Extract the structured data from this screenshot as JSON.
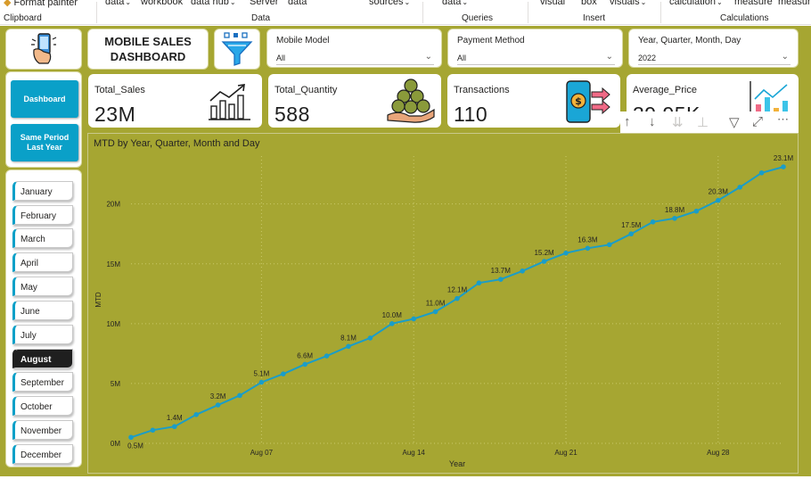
{
  "ribbon": {
    "items": [
      {
        "label": "Format painter",
        "chevron": false
      },
      {
        "label": "data",
        "chevron": true
      },
      {
        "label": "workbook",
        "chevron": false
      },
      {
        "label": "data hub",
        "chevron": true
      },
      {
        "label": "Server",
        "chevron": false
      },
      {
        "label": "data",
        "chevron": false
      },
      {
        "label": "sources",
        "chevron": true
      },
      {
        "label": "data",
        "chevron": true
      },
      {
        "label": "visual",
        "chevron": false
      },
      {
        "label": "box",
        "chevron": false
      },
      {
        "label": "visuals",
        "chevron": true
      },
      {
        "label": "calculation",
        "chevron": true
      },
      {
        "label": "measure",
        "chevron": false
      },
      {
        "label": "measure",
        "chevron": false
      }
    ],
    "groups": [
      "Clipboard",
      "Data",
      "Queries",
      "Insert",
      "Calculations"
    ]
  },
  "header": {
    "title_line1": "MOBILE SALES",
    "title_line2": "DASHBOARD",
    "phone_icon": "mobile-phone-hand-icon",
    "filter_icon": "funnel-filter-icon"
  },
  "slicers": {
    "mobile_model": {
      "label": "Mobile Model",
      "value": "All"
    },
    "payment_method": {
      "label": "Payment Method",
      "value": "All"
    },
    "date": {
      "label": "Year, Quarter, Month, Day",
      "value": "2022"
    }
  },
  "nav": {
    "dashboard": "Dashboard",
    "same_period": "Same Period Last Year"
  },
  "kpis": {
    "total_sales": {
      "label": "Total_Sales",
      "value": "23M"
    },
    "total_quantity": {
      "label": "Total_Quantity",
      "value": "588"
    },
    "transactions": {
      "label": "Transactions",
      "value": "110"
    },
    "average_price": {
      "label": "Average_Price",
      "value": "39.95K"
    }
  },
  "months": [
    "January",
    "February",
    "March",
    "April",
    "May",
    "June",
    "July",
    "August",
    "September",
    "October",
    "November",
    "December"
  ],
  "selected_month": "August",
  "colors": {
    "canvas": "#a6a632",
    "accent": "#0aa0c8",
    "line": "#1a9dc8",
    "selected": "#1f1f1f"
  },
  "chart_data": {
    "type": "line",
    "title": "MTD by Year, Quarter, Month and Day",
    "xlabel": "Year",
    "ylabel": "MTD",
    "x": [
      "Aug 01",
      "Aug 02",
      "Aug 03",
      "Aug 04",
      "Aug 05",
      "Aug 06",
      "Aug 07",
      "Aug 08",
      "Aug 09",
      "Aug 10",
      "Aug 11",
      "Aug 12",
      "Aug 13",
      "Aug 14",
      "Aug 15",
      "Aug 16",
      "Aug 17",
      "Aug 18",
      "Aug 19",
      "Aug 20",
      "Aug 21",
      "Aug 22",
      "Aug 23",
      "Aug 24",
      "Aug 25",
      "Aug 26",
      "Aug 27",
      "Aug 28",
      "Aug 29",
      "Aug 30",
      "Aug 31"
    ],
    "values": [
      0.5,
      1.1,
      1.4,
      2.4,
      3.2,
      4.0,
      5.1,
      5.8,
      6.6,
      7.3,
      8.1,
      8.8,
      10.0,
      10.4,
      11.0,
      12.1,
      13.4,
      13.7,
      14.4,
      15.2,
      15.9,
      16.3,
      16.6,
      17.5,
      18.5,
      18.8,
      19.4,
      20.3,
      21.4,
      22.6,
      23.1
    ],
    "data_labels": {
      "0": "0.5M",
      "2": "1.4M",
      "4": "3.2M",
      "6": "5.1M",
      "8": "6.6M",
      "10": "8.1M",
      "12": "10.0M",
      "14": "11.0M",
      "15": "12.1M",
      "17": "13.7M",
      "19": "15.2M",
      "21": "16.3M",
      "23": "17.5M",
      "25": "18.8M",
      "27": "20.3M",
      "30": "23.1M"
    },
    "x_ticks": [
      "Aug 07",
      "Aug 14",
      "Aug 21",
      "Aug 28"
    ],
    "y_ticks": [
      "0M",
      "5M",
      "10M",
      "15M",
      "20M"
    ],
    "ylim": [
      0,
      24
    ],
    "grid": true
  }
}
